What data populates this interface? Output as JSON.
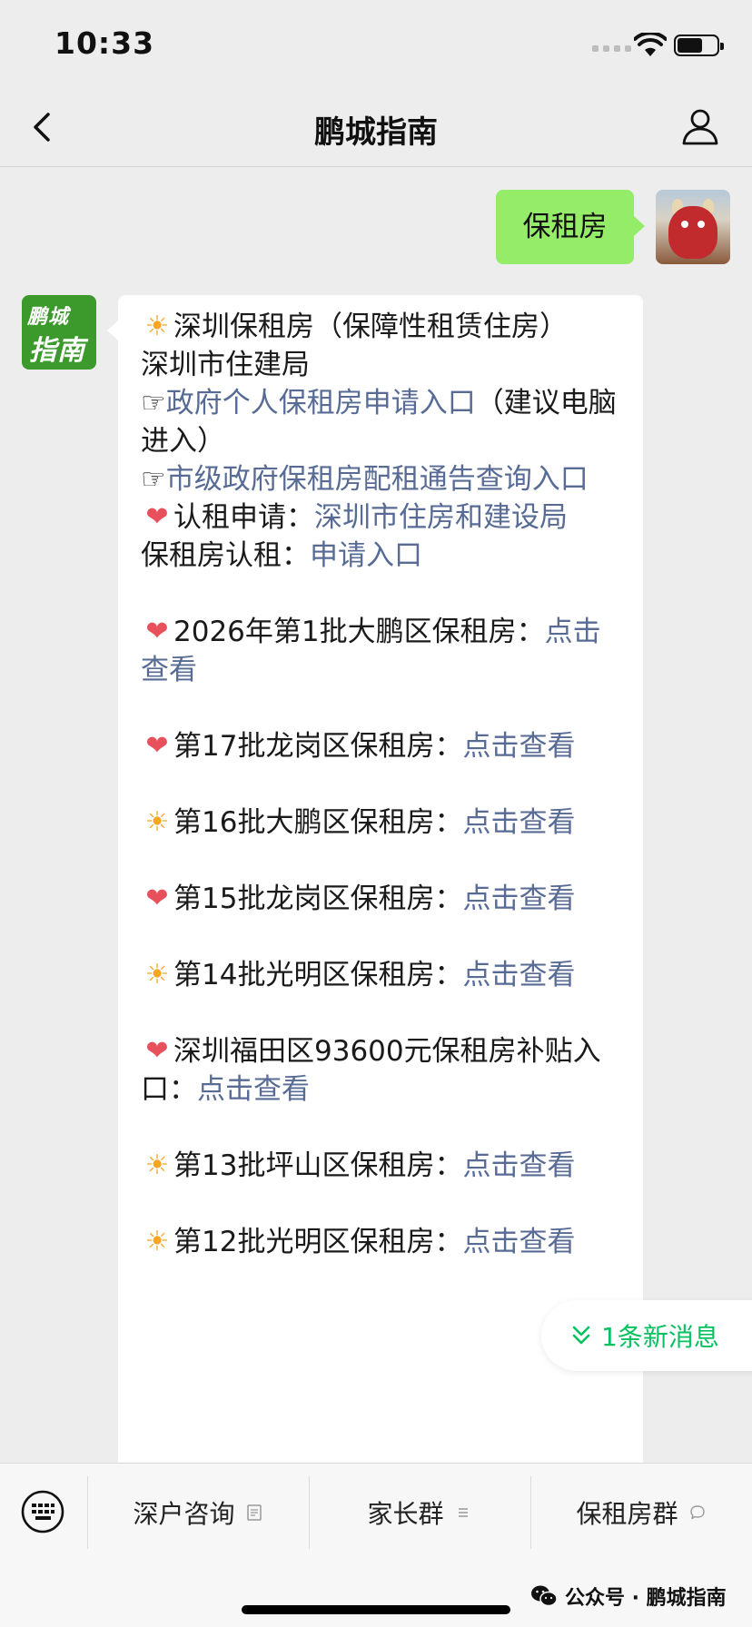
{
  "status_bar": {
    "time": "10:33"
  },
  "nav": {
    "title": "鹏城指南"
  },
  "chat": {
    "sent_message": "保租房",
    "bot_avatar_text": {
      "line1": "鹏城",
      "line2": "指南"
    },
    "reply": {
      "line1": "深圳保租房（保障性租赁住房）",
      "line2": "深圳市住建局",
      "link1_pointer": "☞",
      "link1": "政府个人保租房申请入口",
      "link1_suffix": "（建议电脑进入）",
      "link2_pointer": "☞",
      "link2": "市级政府保租房配租通告查询入口",
      "apply_label": "认租申请：",
      "apply_link": "深圳市住房和建设局",
      "rent_label": "保租房认租：",
      "rent_link": "申请入口",
      "items": [
        {
          "icon": "heart",
          "label": "2026年第1批大鹏区保租房：",
          "link": "点击查看"
        },
        {
          "icon": "heart",
          "label": "第17批龙岗区保租房：",
          "link": "点击查看"
        },
        {
          "icon": "sun",
          "label": "第16批大鹏区保租房：",
          "link": "点击查看"
        },
        {
          "icon": "heart",
          "label": "第15批龙岗区保租房：",
          "link": "点击查看"
        },
        {
          "icon": "sun",
          "label": "第14批光明区保租房：",
          "link": "点击查看"
        },
        {
          "icon": "heart",
          "label": "深圳福田区93600元保租房补贴入口：",
          "link": "点击查看"
        },
        {
          "icon": "sun",
          "label": "第13批坪山区保租房：",
          "link": "点击查看"
        },
        {
          "icon": "sun",
          "label": "第12批光明区保租房：",
          "link": "点击查看"
        }
      ]
    },
    "new_message_pill": "1条新消息"
  },
  "menu": {
    "items": [
      {
        "label": "深户咨询"
      },
      {
        "label": "家长群"
      },
      {
        "label": "保租房群"
      }
    ]
  },
  "brand": {
    "text": "公众号 · 鹏城指南"
  },
  "colors": {
    "background": "#ededed",
    "sent_bubble": "#95ec69",
    "link": "#576b95",
    "wechat_green": "#07c160",
    "bot_avatar": "#3c9a2c"
  },
  "icons": {
    "back": "chevron-left",
    "profile": "person-outline",
    "keyboard": "keyboard",
    "sun_emoji": "sun-with-face",
    "heart_emoji": "red-heart",
    "pill": "double-chevron-down"
  }
}
